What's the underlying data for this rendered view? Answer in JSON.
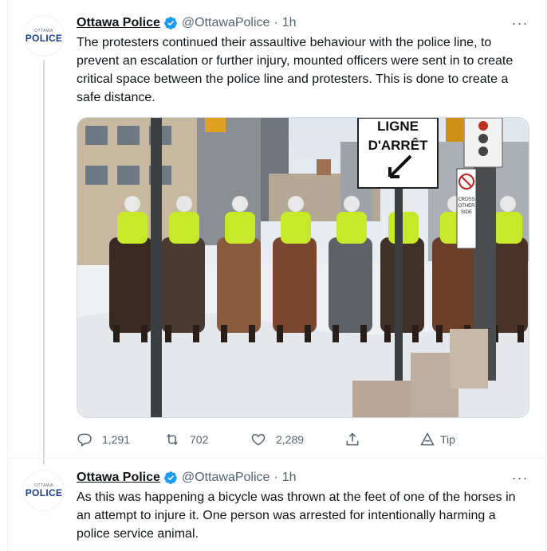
{
  "tweets": [
    {
      "author_name": "Ottawa Police",
      "handle": "@OttawaPolice",
      "separator": "·",
      "time": "1h",
      "more": "···",
      "avatar": {
        "small": "OTTAWA",
        "big": "POLICE"
      },
      "text": "The protesters continued their assaultive behaviour with the police line, to prevent an escalation or further injury, mounted officers were sent in to create critical space between the police line and protesters. This is done to create a safe distance.",
      "media": {
        "sign_line1": "LIGNE",
        "sign_line2": "D'ARRÊT",
        "small_sign_line1": "CROSS",
        "small_sign_line2": "OTHER",
        "small_sign_line3": "SIDE"
      },
      "actions": {
        "replies": "1,291",
        "retweets": "702",
        "likes": "2,289",
        "tip": "Tip"
      }
    },
    {
      "author_name": "Ottawa Police",
      "handle": "@OttawaPolice",
      "separator": "·",
      "time": "1h",
      "more": "···",
      "avatar": {
        "small": "OTTAWA",
        "big": "POLICE"
      },
      "text": "As this was happening a bicycle was thrown at the feet of one of the horses in an attempt to injure it. One person was arrested for intentionally harming a police service animal."
    }
  ],
  "colors": {
    "verified": "#1d9bf0",
    "muted": "#536471",
    "vest": "#c8e82a"
  }
}
